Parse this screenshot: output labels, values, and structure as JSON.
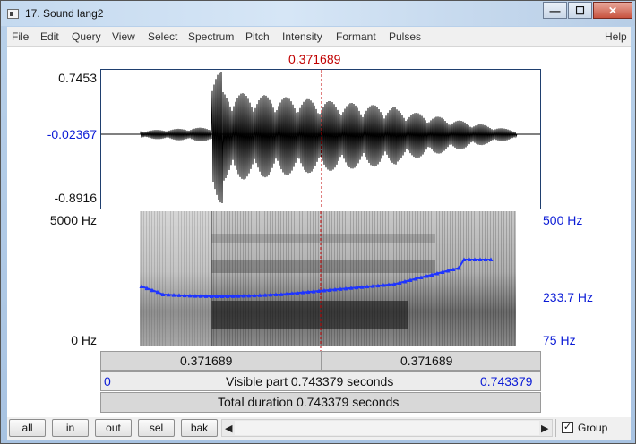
{
  "window": {
    "title": "17. Sound lang2",
    "minimize_glyph": "—",
    "maximize_glyph": "☐",
    "close_glyph": "✕"
  },
  "menu": [
    "File",
    "Edit",
    "Query",
    "View",
    "Select",
    "Spectrum",
    "Pitch",
    "Intensity",
    "Formant",
    "Pulses"
  ],
  "help_label": "Help",
  "cursor_time": "0.371689",
  "waveform": {
    "y_max": "0.7453",
    "y_mid": "-0.02367",
    "y_min": "-0.8916"
  },
  "spectrogram": {
    "freq_top": "5000 Hz",
    "freq_bottom": "0 Hz",
    "pitch_top": "500 Hz",
    "pitch_mid": "233.7 Hz",
    "pitch_bottom": "75 Hz"
  },
  "bars": {
    "left_segment": "0.371689",
    "right_segment": "0.371689",
    "visible_start": "0",
    "visible_label": "Visible part 0.743379 seconds",
    "visible_end": "0.743379",
    "total_label": "Total duration 0.743379 seconds"
  },
  "buttons": {
    "all": "all",
    "in": "in",
    "out": "out",
    "sel": "sel",
    "bak": "bak"
  },
  "scroll": {
    "left_arrow": "◀",
    "right_arrow": "▶"
  },
  "group": {
    "label": "Group",
    "checked": true,
    "check_glyph": "✓"
  },
  "colors": {
    "cursor": "#c00000",
    "pitch": "#1f34ff",
    "axis_blue": "#0b1bd6"
  }
}
